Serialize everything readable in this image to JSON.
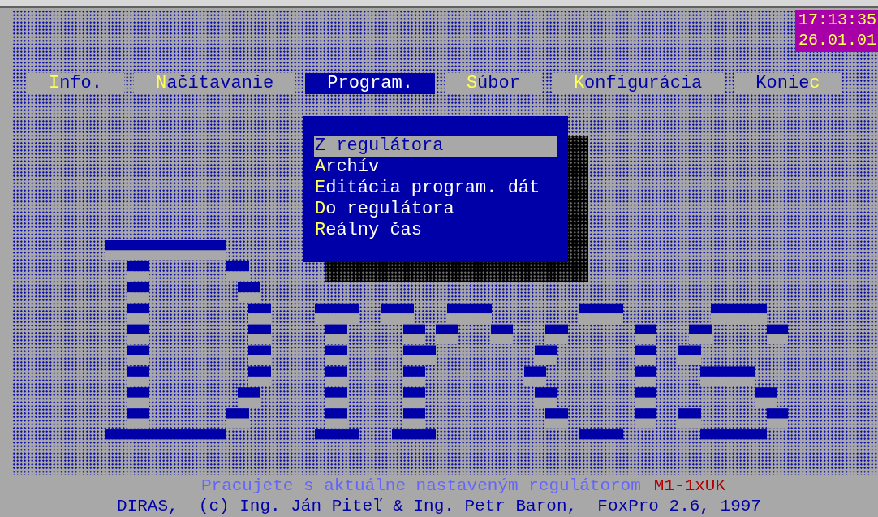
{
  "clock": {
    "time": "17:13:35",
    "date": "26.01.01"
  },
  "menu": [
    {
      "hotkey": "I",
      "after": "nfo.",
      "selected": false
    },
    {
      "hotkey": "N",
      "after": "ačítavanie",
      "selected": false
    },
    {
      "hotkey": "P",
      "after": "rogram.",
      "selected": true
    },
    {
      "hotkey": "S",
      "after": "úbor",
      "selected": false
    },
    {
      "hotkey": "K",
      "after": "onfigurácia",
      "selected": false
    },
    {
      "before": "Konie",
      "hotkey": "c",
      "selected": false
    }
  ],
  "submenu": [
    {
      "hotkey": "Z",
      "after": " regulátora",
      "selected": true
    },
    {
      "hotkey": "A",
      "after": "rchív",
      "selected": false
    },
    {
      "hotkey": "E",
      "after": "ditácia program. dát",
      "selected": false
    },
    {
      "hotkey": "D",
      "after": "o regulátora",
      "selected": false
    },
    {
      "hotkey": "R",
      "after": "eálny čas",
      "selected": false
    }
  ],
  "status": {
    "message": "Pracujete s aktuálne nastaveným regulátorom",
    "regulator": "M1-1xUK"
  },
  "credits": "DIRAS,  (c) Ing. Ján Piteľ & Ing. Petr Baron,  FoxPro 2.6, 1997"
}
